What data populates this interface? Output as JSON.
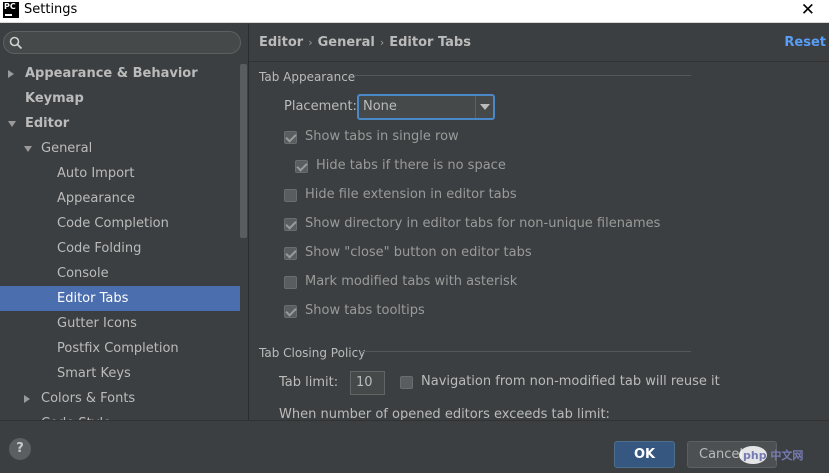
{
  "window": {
    "title": "Settings",
    "app_icon_text": "PC"
  },
  "sidebar": {
    "search": {
      "placeholder": ""
    },
    "items": [
      {
        "label": "Appearance & Behavior",
        "level": 0,
        "bold": true,
        "arrow": "right"
      },
      {
        "label": "Keymap",
        "level": 0,
        "bold": true,
        "arrow": ""
      },
      {
        "label": "Editor",
        "level": 0,
        "bold": true,
        "arrow": "down"
      },
      {
        "label": "General",
        "level": 1,
        "bold": false,
        "arrow": "down"
      },
      {
        "label": "Auto Import",
        "level": 2,
        "bold": false,
        "arrow": ""
      },
      {
        "label": "Appearance",
        "level": 2,
        "bold": false,
        "arrow": ""
      },
      {
        "label": "Code Completion",
        "level": 2,
        "bold": false,
        "arrow": ""
      },
      {
        "label": "Code Folding",
        "level": 2,
        "bold": false,
        "arrow": ""
      },
      {
        "label": "Console",
        "level": 2,
        "bold": false,
        "arrow": ""
      },
      {
        "label": "Editor Tabs",
        "level": 2,
        "bold": false,
        "arrow": "",
        "selected": true
      },
      {
        "label": "Gutter Icons",
        "level": 2,
        "bold": false,
        "arrow": ""
      },
      {
        "label": "Postfix Completion",
        "level": 2,
        "bold": false,
        "arrow": ""
      },
      {
        "label": "Smart Keys",
        "level": 2,
        "bold": false,
        "arrow": ""
      },
      {
        "label": "Colors & Fonts",
        "level": 1,
        "bold": false,
        "arrow": "right"
      },
      {
        "label": "Code Style",
        "level": 1,
        "bold": false,
        "arrow": "right"
      }
    ]
  },
  "header": {
    "breadcrumb": [
      "Editor",
      "General",
      "Editor Tabs"
    ],
    "breadcrumb_sep": "›",
    "reset_label": "Reset"
  },
  "tab_appearance": {
    "title": "Tab Appearance",
    "placement_label": "Placement:",
    "placement_value": "None",
    "options": [
      {
        "label": "Show tabs in single row",
        "checked": true,
        "disabled": true,
        "indent": 0
      },
      {
        "label": "Hide tabs if there is no space",
        "checked": true,
        "disabled": true,
        "indent": 1
      },
      {
        "label": "Hide file extension in editor tabs",
        "checked": false,
        "disabled": true,
        "indent": 0
      },
      {
        "label": "Show directory in editor tabs for non-unique filenames",
        "checked": true,
        "disabled": true,
        "indent": 0
      },
      {
        "label": "Show \"close\" button on editor tabs",
        "checked": true,
        "disabled": true,
        "indent": 0
      },
      {
        "label": "Mark modified tabs with asterisk",
        "checked": false,
        "disabled": true,
        "indent": 0
      },
      {
        "label": "Show tabs tooltips",
        "checked": true,
        "disabled": true,
        "indent": 0
      }
    ]
  },
  "tab_closing": {
    "title": "Tab Closing Policy",
    "tab_limit_label": "Tab limit:",
    "tab_limit_value": "10",
    "reuse_label": "Navigation from non-modified tab will reuse it",
    "reuse_checked": false,
    "when_text": "When number of opened editors exceeds tab limit:"
  },
  "footer": {
    "help_label": "?",
    "ok_label": "OK",
    "cancel_label": "Cancel",
    "watermark_text": "php 中文网"
  },
  "colors": {
    "background": "#3c3f41",
    "selection": "#4b6eaf",
    "accent_link": "#589df6",
    "ok_button": "#365880"
  }
}
